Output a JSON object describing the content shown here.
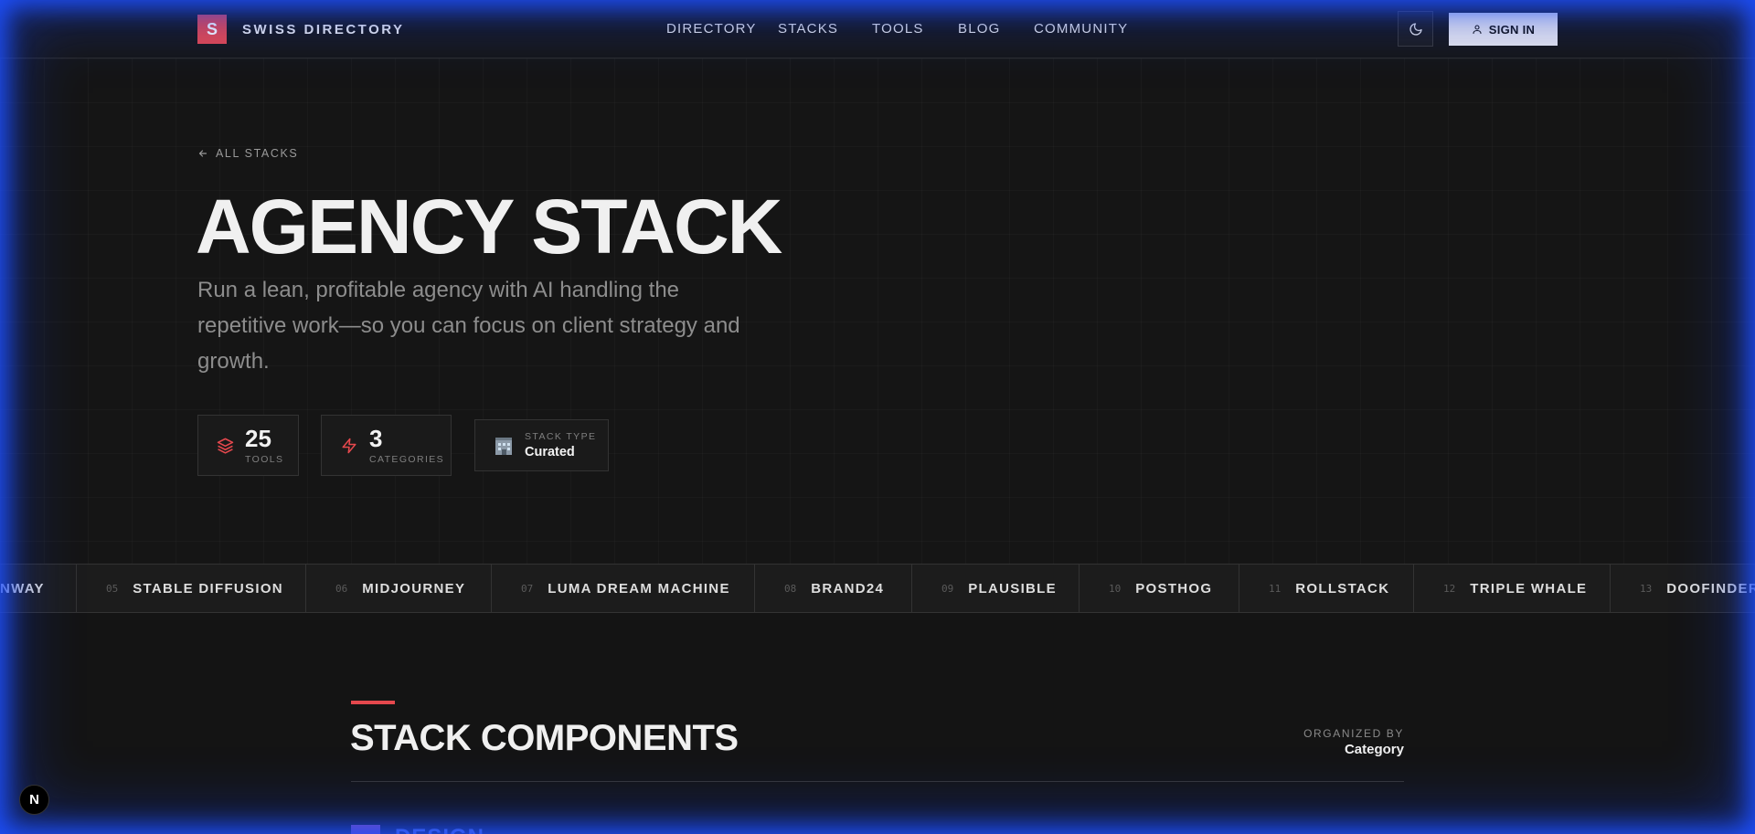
{
  "brand": {
    "logo_letter": "S",
    "name": "SWISS DIRECTORY",
    "accent": "#e5484d"
  },
  "nav": [
    "DIRECTORY",
    "STACKS",
    "TOOLS",
    "BLOG",
    "COMMUNITY"
  ],
  "header": {
    "theme_icon": "moon-icon",
    "signin_label": "SIGN IN",
    "signin_icon": "user-icon"
  },
  "hero": {
    "back_label": "ALL STACKS",
    "title": "AGENCY STACK",
    "description": "Run a lean, profitable agency with AI handling the repetitive work—so you can focus on client strategy and growth.",
    "stats": [
      {
        "icon": "layers-icon",
        "value": "25",
        "label": "TOOLS"
      },
      {
        "icon": "bolt-icon",
        "value": "3",
        "label": "CATEGORIES"
      },
      {
        "icon": "building-icon",
        "label": "STACK TYPE",
        "value": "Curated"
      }
    ]
  },
  "ticker": [
    {
      "num": "",
      "name": "NWAY"
    },
    {
      "num": "05",
      "name": "STABLE DIFFUSION"
    },
    {
      "num": "06",
      "name": "MIDJOURNEY"
    },
    {
      "num": "07",
      "name": "LUMA DREAM MACHINE"
    },
    {
      "num": "08",
      "name": "BRAND24"
    },
    {
      "num": "09",
      "name": "PLAUSIBLE"
    },
    {
      "num": "10",
      "name": "POSTHOG"
    },
    {
      "num": "11",
      "name": "ROLLSTACK"
    },
    {
      "num": "12",
      "name": "TRIPLE WHALE"
    },
    {
      "num": "13",
      "name": "DOOFINDER"
    }
  ],
  "components": {
    "title": "STACK COMPONENTS",
    "organized_label": "ORGANIZED BY",
    "organized_value": "Category",
    "first_category": "DESIGN"
  },
  "badge": {
    "letter": "N"
  }
}
